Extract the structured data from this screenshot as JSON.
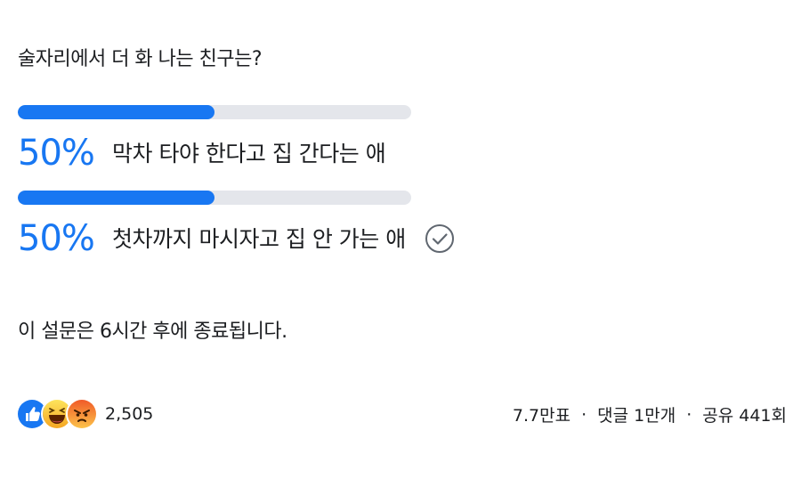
{
  "poll": {
    "question": "술자리에서 더 화 나는 친구는?",
    "options": [
      {
        "percent_label": "50%",
        "percent": 50,
        "label": "막차 타야 한다고 집 간다는 애",
        "selected": false
      },
      {
        "percent_label": "50%",
        "percent": 50,
        "label": "첫차까지 마시자고 집 안 가는 애",
        "selected": true
      }
    ],
    "status": "이 설문은 6시간 후에 종료됩니다."
  },
  "footer": {
    "reactions": {
      "icons": [
        "like-icon",
        "haha-icon",
        "angry-icon"
      ],
      "count": "2,505"
    },
    "votes": "7.7만표",
    "comments": "댓글 1만개",
    "shares": "공유 441회",
    "separator": "·"
  },
  "colors": {
    "accent": "#1877f2",
    "track": "#e4e6eb",
    "text": "#1c1e21"
  }
}
